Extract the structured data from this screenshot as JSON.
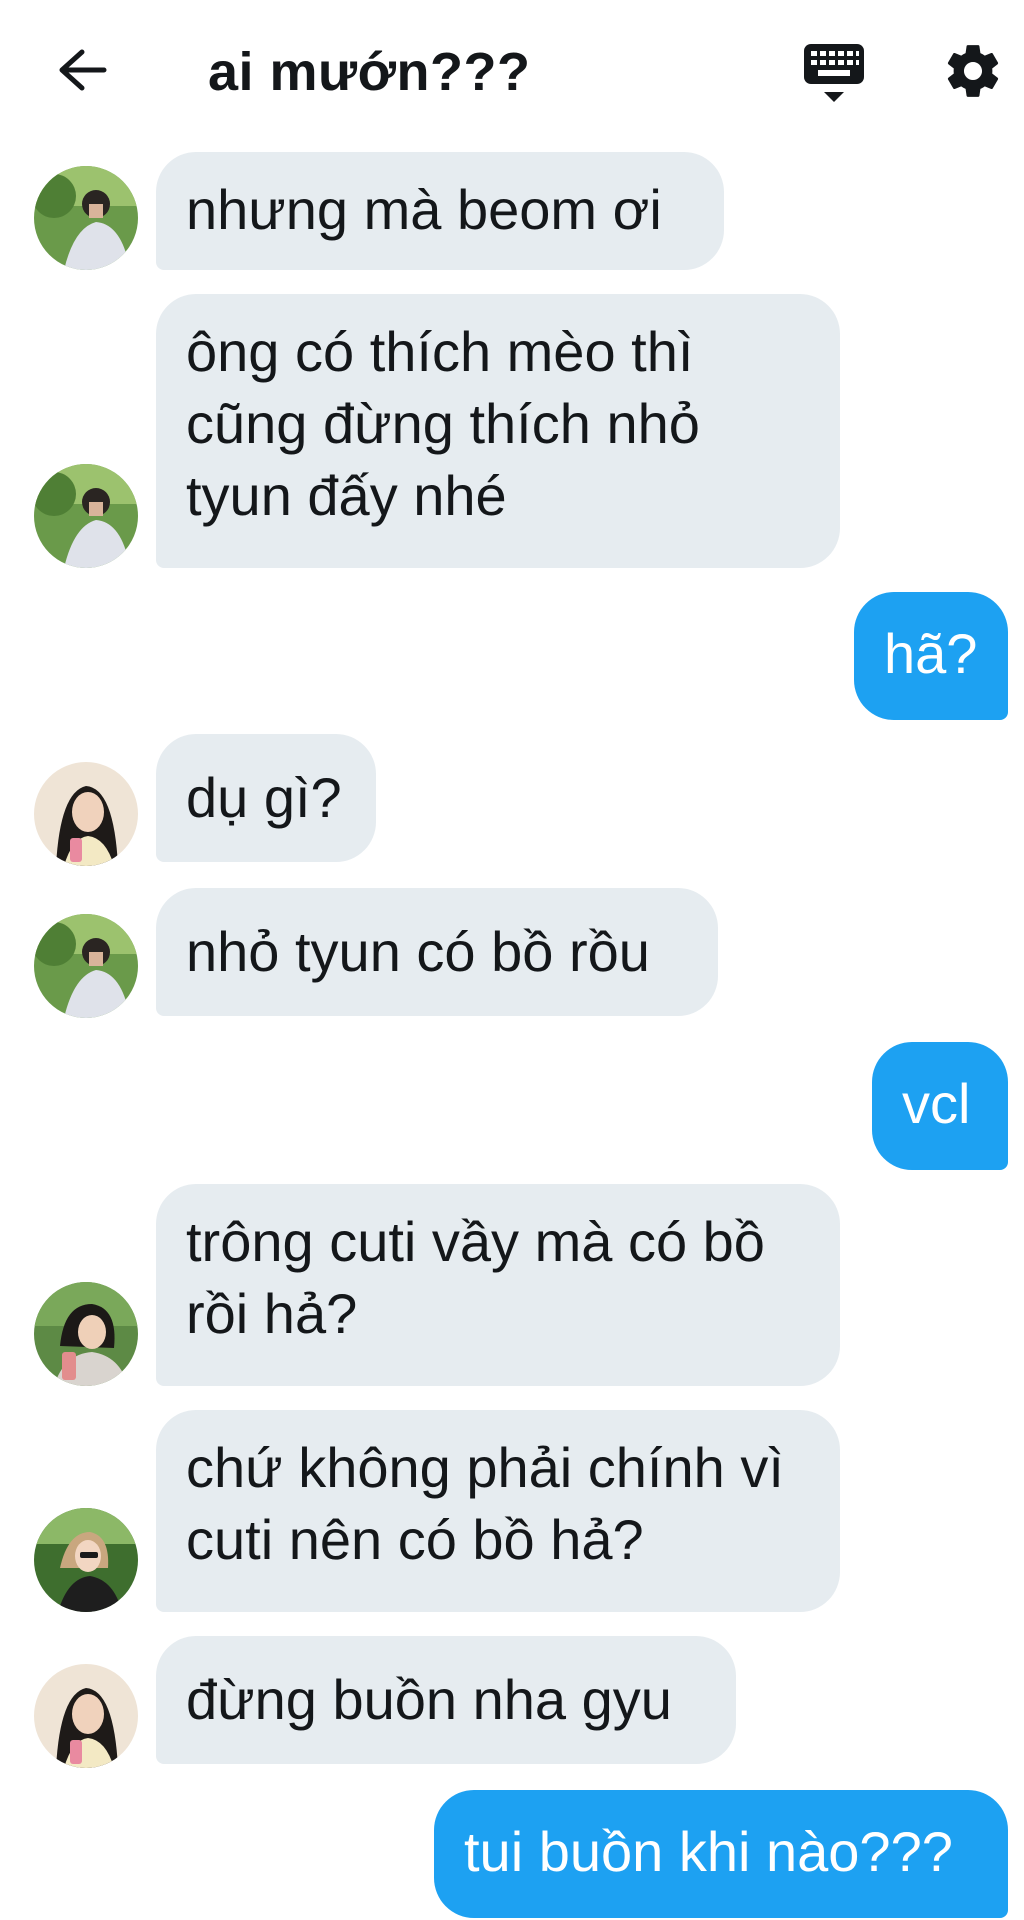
{
  "header": {
    "title": "ai mướn???",
    "back_icon": "arrow-left-icon",
    "keyboard_icon": "keyboard-icon",
    "settings_icon": "gear-icon"
  },
  "colors": {
    "incoming_bubble": "#e6ecf0",
    "outgoing_bubble": "#1da1f2",
    "text": "#14171a"
  },
  "messages": [
    {
      "direction": "incoming",
      "sender_avatar": "avatar-a",
      "text": "nhưng mà beom ơi"
    },
    {
      "direction": "incoming",
      "sender_avatar": "avatar-a",
      "text": "ông có thích mèo thì cũng đừng thích nhỏ tyun đấy nhé"
    },
    {
      "direction": "outgoing",
      "text": "hã?"
    },
    {
      "direction": "incoming",
      "sender_avatar": "avatar-b",
      "text": "dụ gì?"
    },
    {
      "direction": "incoming",
      "sender_avatar": "avatar-a",
      "text": "nhỏ tyun có bồ rồu"
    },
    {
      "direction": "outgoing",
      "text": "vcl"
    },
    {
      "direction": "incoming",
      "sender_avatar": "avatar-c",
      "text": "trông cuti vầy mà có bồ rồi hả?"
    },
    {
      "direction": "incoming",
      "sender_avatar": "avatar-d",
      "text": "chứ không phải chính vì cuti nên có bồ hả?"
    },
    {
      "direction": "incoming",
      "sender_avatar": "avatar-b",
      "text": "đừng buồn nha gyu"
    },
    {
      "direction": "outgoing",
      "text": "tui buồn khi nào???"
    }
  ]
}
